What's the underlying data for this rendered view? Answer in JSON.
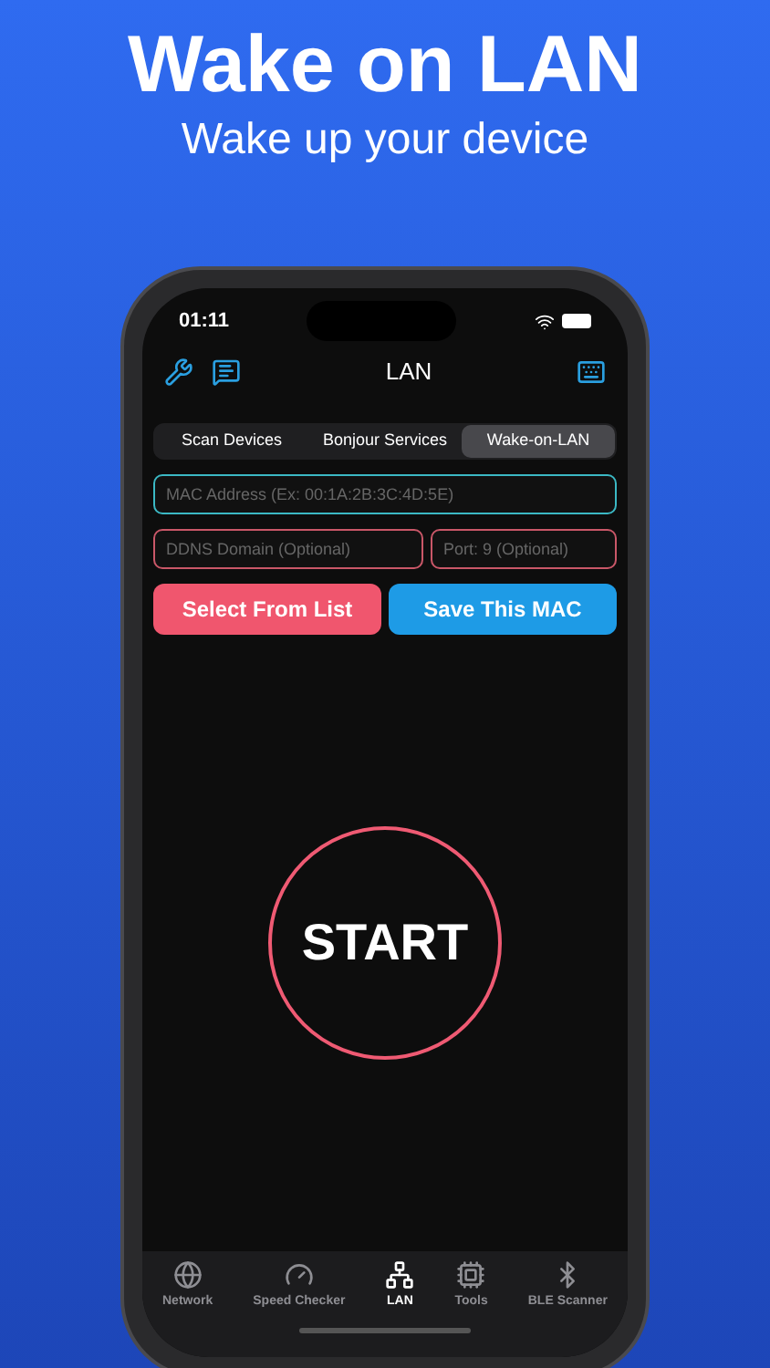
{
  "headline": "Wake on LAN",
  "subheadline": "Wake up your device",
  "status_bar": {
    "time": "01:11"
  },
  "nav": {
    "title": "LAN"
  },
  "segments": [
    {
      "label": "Scan Devices",
      "selected": false
    },
    {
      "label": "Bonjour Services",
      "selected": false
    },
    {
      "label": "Wake-on-LAN",
      "selected": true
    }
  ],
  "mac_field": {
    "placeholder": "MAC Address (Ex: 00:1A:2B:3C:4D:5E)"
  },
  "ddns_field": {
    "placeholder": "DDNS Domain (Optional)"
  },
  "port_field": {
    "placeholder": "Port: 9 (Optional)"
  },
  "buttons": [
    {
      "label": "Select From List",
      "kind": "pink"
    },
    {
      "label": "Save This MAC",
      "kind": "blue"
    }
  ],
  "start_button": {
    "label": "START"
  },
  "tab_bar": [
    {
      "label": "Network",
      "kind": "globe",
      "selected": false
    },
    {
      "label": "Speed Checker",
      "kind": "gauge",
      "selected": false
    },
    {
      "label": "LAN",
      "kind": "network",
      "selected": true
    },
    {
      "label": "Tools",
      "kind": "chip",
      "selected": false
    },
    {
      "label": "BLE Scanner",
      "kind": "bluetooth",
      "selected": false
    }
  ]
}
